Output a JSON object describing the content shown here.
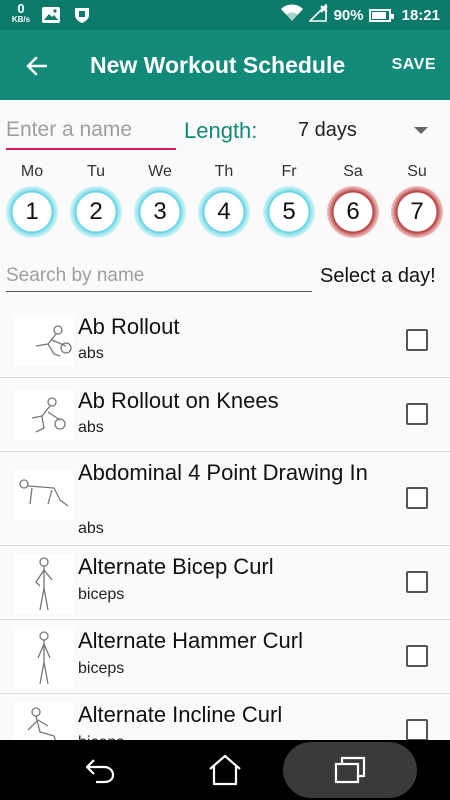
{
  "status_bar": {
    "net_speed_value": "0",
    "net_speed_unit": "KB/s",
    "battery": "90%",
    "battery_level": 0.9,
    "time": "18:21",
    "icons": [
      "image-icon",
      "shield-icon",
      "wifi-icon",
      "signal-icon",
      "battery-icon"
    ]
  },
  "app_bar": {
    "title": "New Workout Schedule",
    "save_label": "SAVE",
    "background": "#128a79"
  },
  "form": {
    "name_placeholder": "Enter a name",
    "length_label": "Length:",
    "length_value": "7 days"
  },
  "days": [
    {
      "label": "Mo",
      "number": "1",
      "color": "blue"
    },
    {
      "label": "Tu",
      "number": "2",
      "color": "blue"
    },
    {
      "label": "We",
      "number": "3",
      "color": "blue"
    },
    {
      "label": "Th",
      "number": "4",
      "color": "blue"
    },
    {
      "label": "Fr",
      "number": "5",
      "color": "blue"
    },
    {
      "label": "Sa",
      "number": "6",
      "color": "red"
    },
    {
      "label": "Su",
      "number": "7",
      "color": "red"
    }
  ],
  "search": {
    "placeholder": "Search by name",
    "hint": "Select a day!"
  },
  "exercises": [
    {
      "name": "Ab Rollout",
      "category": "abs",
      "checked": false
    },
    {
      "name": "Ab Rollout on Knees",
      "category": "abs",
      "checked": false
    },
    {
      "name": "Abdominal 4 Point Drawing In",
      "category": "abs",
      "checked": false
    },
    {
      "name": "Alternate Bicep Curl",
      "category": "biceps",
      "checked": false
    },
    {
      "name": "Alternate Hammer Curl",
      "category": "biceps",
      "checked": false
    },
    {
      "name": "Alternate Incline Curl",
      "category": "biceps",
      "checked": false
    }
  ],
  "colors": {
    "accent": "#128a79",
    "status_bar": "#0b7a6b",
    "input_underline": "#d81b60",
    "weekday_ring": "#5fd3e2",
    "weekend_ring": "#b33b3b"
  }
}
